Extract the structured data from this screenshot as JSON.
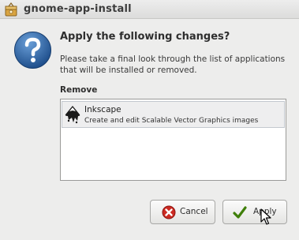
{
  "window": {
    "title": "gnome-app-install",
    "app_icon": "package-icon"
  },
  "dialog": {
    "icon": "question-icon",
    "heading": "Apply the following changes?",
    "description": "Please take a final look through the list of applications that will be installed or removed.",
    "section_label": "Remove",
    "items": [
      {
        "name": "Inkscape",
        "description": "Create and edit Scalable Vector Graphics images",
        "icon": "inkscape-icon"
      }
    ]
  },
  "buttons": {
    "cancel_label": "Cancel",
    "apply_label": "Apply",
    "cancel_icon": "cancel-icon",
    "apply_icon": "checkmark-icon"
  },
  "colors": {
    "window_bg": "#ededec",
    "question_icon": "#2a5f9e",
    "cancel_red": "#c8201a",
    "apply_green": "#4e9a06"
  }
}
